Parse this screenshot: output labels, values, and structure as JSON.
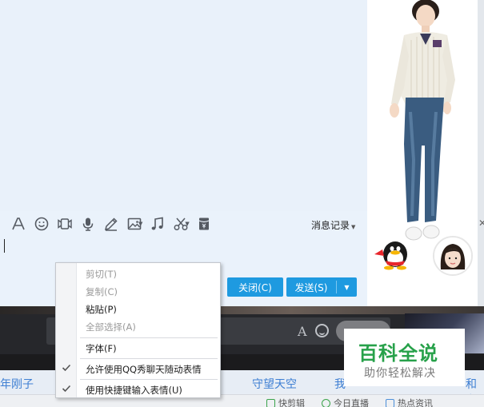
{
  "chat": {
    "toolbar": {
      "icons": [
        "font-icon",
        "emoji-icon",
        "video-icon",
        "microphone-icon",
        "pen-icon",
        "image-icon",
        "music-icon",
        "scissors-icon",
        "red-packet-icon"
      ]
    },
    "history_label": "消息记录",
    "close_label": "关闭(C)",
    "send_label": "发送(S)"
  },
  "context_menu": {
    "items": [
      {
        "label": "剪切(T)",
        "enabled": false,
        "checked": false
      },
      {
        "label": "复制(C)",
        "enabled": false,
        "checked": false
      },
      {
        "label": "粘贴(P)",
        "enabled": true,
        "checked": false
      },
      {
        "label": "全部选择(A)",
        "enabled": false,
        "checked": false
      },
      {
        "label": "字体(F)",
        "enabled": true,
        "checked": false
      },
      {
        "label": "允许使用QQ秀聊天随动表情",
        "enabled": true,
        "checked": true
      },
      {
        "label": "使用快捷键输入表情(U)",
        "enabled": true,
        "checked": true
      }
    ]
  },
  "background": {
    "strip_items": [
      "年刚子",
      "守望天空",
      "我",
      "和女"
    ],
    "status_items": [
      "快剪辑",
      "今日直播",
      "热点资讯"
    ]
  },
  "watermark": {
    "title": "百科全说",
    "subtitle": "助你轻松解决"
  },
  "colors": {
    "accent": "#1e9ae0",
    "chat_bg": "#eaf2fb",
    "watermark_green": "#27a14a"
  }
}
